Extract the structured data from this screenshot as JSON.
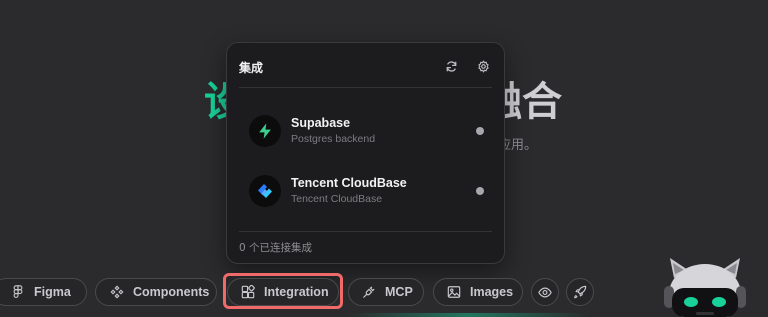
{
  "hero": {
    "title_left": "设",
    "title_right": "融合",
    "subtitle_fragment": "应用。"
  },
  "popover": {
    "title": "集成",
    "refresh_icon": "refresh-icon",
    "settings_icon": "gear-icon",
    "integrations": [
      {
        "name": "Supabase",
        "description": "Postgres backend",
        "status": "disconnected",
        "logo_color": "#3ecf8e"
      },
      {
        "name": "Tencent CloudBase",
        "description": "Tencent CloudBase",
        "status": "disconnected",
        "logo_color": "#2b7cff"
      }
    ],
    "footer": "0 个已连接集成"
  },
  "toolbar": {
    "figma_label": "Figma",
    "components_label": "Components",
    "integration_label": "Integration",
    "mcp_label": "MCP",
    "images_label": "Images",
    "eye_icon": "eye-icon",
    "rocket_icon": "rocket-icon",
    "active": "Integration",
    "highlight_color": "#f06a6a"
  },
  "colors": {
    "background": "#2b2b2d",
    "popover_bg": "#1c1c1e",
    "accent_green": "#19d19a"
  }
}
